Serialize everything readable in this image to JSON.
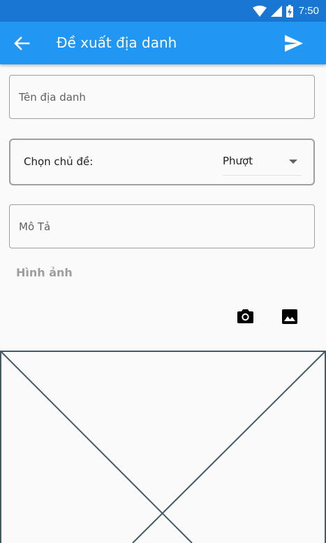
{
  "status_bar": {
    "time": "7:50",
    "icons": [
      "wifi-icon",
      "signal-icon",
      "battery-charging-icon"
    ],
    "color": "#1976d2"
  },
  "app_bar": {
    "title": "Đề xuất địa danh",
    "back_icon": "arrow-back-icon",
    "send_icon": "send-icon",
    "color": "#2196f3"
  },
  "form": {
    "name_placeholder": "Tên địa danh",
    "name_value": "",
    "topic_label": "Chọn chủ đề:",
    "topic_value": "Phượt",
    "description_placeholder": "Mô Tả",
    "description_value": "",
    "images_label": "Hình ảnh",
    "camera_icon": "camera-icon",
    "gallery_icon": "image-icon"
  },
  "colors": {
    "primary": "#2196f3",
    "primary_dark": "#1976d2",
    "outline": "#9e9e9e",
    "placeholder_lines": "#455a64"
  }
}
